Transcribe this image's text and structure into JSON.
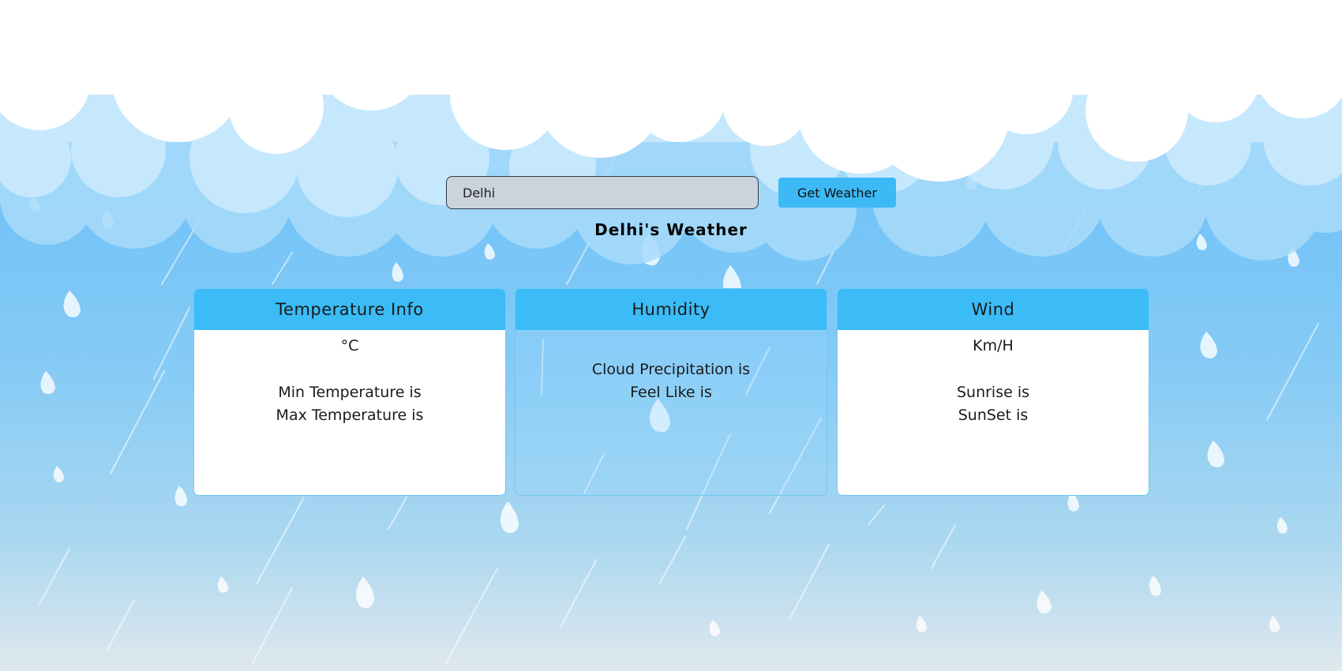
{
  "search": {
    "value": "Delhi",
    "button_label": "Get Weather"
  },
  "heading": "Delhi's Weather",
  "cards": {
    "temperature": {
      "title": "Temperature Info",
      "unit": "°C",
      "min_label": "Min Temperature is",
      "max_label": "Max Temperature is"
    },
    "humidity": {
      "title": "Humidity",
      "cloud_label": "Cloud Precipitation is",
      "feels_label": "Feel Like is"
    },
    "wind": {
      "title": "Wind",
      "unit": "Km/H",
      "sunrise_label": "Sunrise is",
      "sunset_label": "SunSet is"
    }
  },
  "colors": {
    "card_header": "#3bbcf6",
    "button": "#3dbaf5",
    "input_bg": "#cbd3dd"
  },
  "background": {
    "description_icon": "rain-clouds-background"
  }
}
